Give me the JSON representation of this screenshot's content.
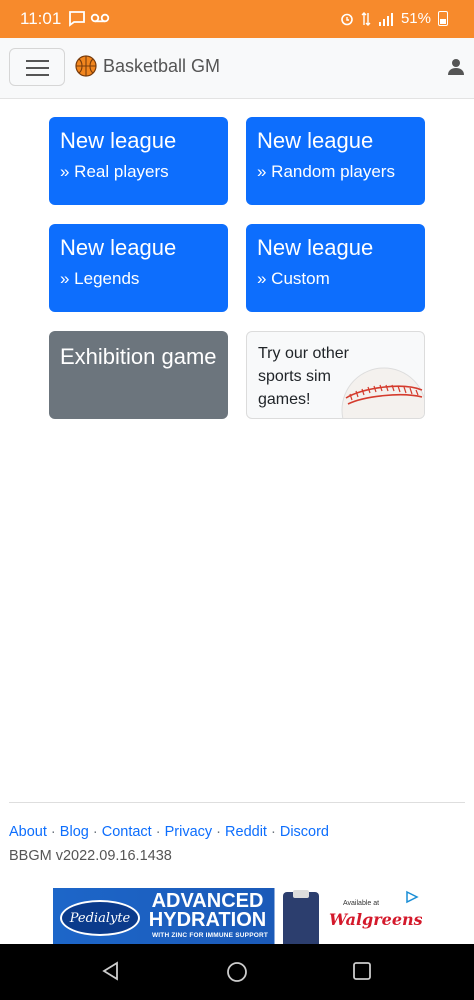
{
  "status_bar": {
    "time": "11:01",
    "battery": "51%",
    "icons": [
      "message-icon",
      "voicemail-icon",
      "alarm-icon",
      "data-icon",
      "signal-icon",
      "battery-icon"
    ]
  },
  "navbar": {
    "brand": "Basketball GM",
    "icons": [
      "menu-icon",
      "basketball-icon",
      "user-icon"
    ]
  },
  "tiles": [
    {
      "title": "New league",
      "sub": "» Real players"
    },
    {
      "title": "New league",
      "sub": "» Random players"
    },
    {
      "title": "New league",
      "sub": "» Legends"
    },
    {
      "title": "New league",
      "sub": "» Custom"
    },
    {
      "title": "Exhibition game"
    },
    {
      "title": "Try our other sports sim games!"
    }
  ],
  "footer": {
    "links": [
      "About",
      "Blog",
      "Contact",
      "Privacy",
      "Reddit",
      "Discord"
    ],
    "separator": " · ",
    "version": "BBGM v2022.09.16.1438"
  },
  "ad": {
    "logo": "Pedialyte",
    "headline": "ADVANCED HYDRATION",
    "tagline": "WITH ZINC FOR IMMUNE SUPPORT",
    "available": "Available at",
    "retailer": "Walgreens"
  },
  "colors": {
    "status_bar": "#f78a2c",
    "primary": "#0d6efd",
    "secondary": "#6c757d"
  }
}
